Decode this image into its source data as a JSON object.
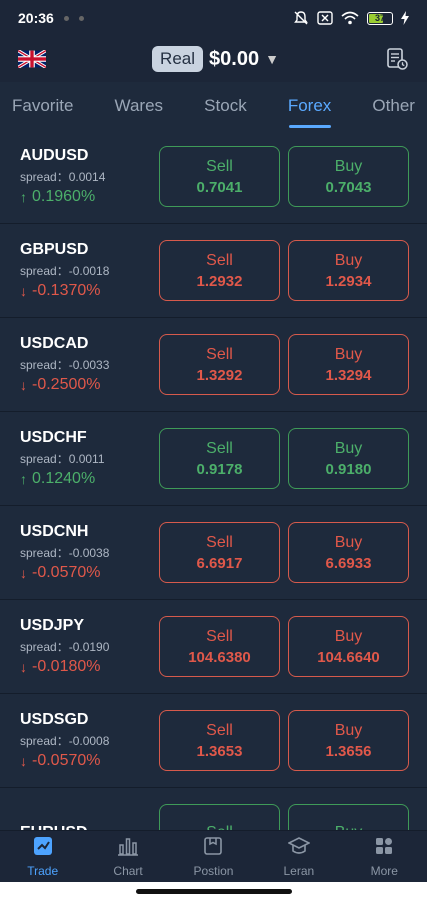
{
  "status": {
    "time": "20:36",
    "battery": "37"
  },
  "header": {
    "account_type": "Real",
    "balance": "$0.00",
    "caret": "▼"
  },
  "tabs": [
    {
      "label": "Favorite",
      "active": false
    },
    {
      "label": "Wares",
      "active": false
    },
    {
      "label": "Stock",
      "active": false
    },
    {
      "label": "Forex",
      "active": true
    },
    {
      "label": "Other",
      "active": false
    }
  ],
  "quotes": [
    {
      "symbol": "AUDUSD",
      "spread": "spread：0.0014",
      "change": "0.1960%",
      "direction": "up",
      "sell_label": "Sell",
      "sell": "0.7041",
      "buy_label": "Buy",
      "buy": "0.7043",
      "color": "green"
    },
    {
      "symbol": "GBPUSD",
      "spread": "spread：-0.0018",
      "change": "-0.1370%",
      "direction": "down",
      "sell_label": "Sell",
      "sell": "1.2932",
      "buy_label": "Buy",
      "buy": "1.2934",
      "color": "red"
    },
    {
      "symbol": "USDCAD",
      "spread": "spread：-0.0033",
      "change": "-0.2500%",
      "direction": "down",
      "sell_label": "Sell",
      "sell": "1.3292",
      "buy_label": "Buy",
      "buy": "1.3294",
      "color": "red"
    },
    {
      "symbol": "USDCHF",
      "spread": "spread：0.0011",
      "change": "0.1240%",
      "direction": "up",
      "sell_label": "Sell",
      "sell": "0.9178",
      "buy_label": "Buy",
      "buy": "0.9180",
      "color": "green"
    },
    {
      "symbol": "USDCNH",
      "spread": "spread：-0.0038",
      "change": "-0.0570%",
      "direction": "down",
      "sell_label": "Sell",
      "sell": "6.6917",
      "buy_label": "Buy",
      "buy": "6.6933",
      "color": "red"
    },
    {
      "symbol": "USDJPY",
      "spread": "spread：-0.0190",
      "change": "-0.0180%",
      "direction": "down",
      "sell_label": "Sell",
      "sell": "104.6380",
      "buy_label": "Buy",
      "buy": "104.6640",
      "color": "red"
    },
    {
      "symbol": "USDSGD",
      "spread": "spread：-0.0008",
      "change": "-0.0570%",
      "direction": "down",
      "sell_label": "Sell",
      "sell": "1.3653",
      "buy_label": "Buy",
      "buy": "1.3656",
      "color": "red"
    },
    {
      "symbol": "EURUSD",
      "spread": "",
      "change": "",
      "direction": "up",
      "sell_label": "Sell",
      "sell": "",
      "buy_label": "Buy",
      "buy": "",
      "color": "green"
    }
  ],
  "nav": [
    {
      "label": "Trade",
      "icon": "trade-icon",
      "active": true
    },
    {
      "label": "Chart",
      "icon": "chart-icon",
      "active": false
    },
    {
      "label": "Postion",
      "icon": "position-icon",
      "active": false
    },
    {
      "label": "Leran",
      "icon": "learn-icon",
      "active": false
    },
    {
      "label": "More",
      "icon": "more-icon",
      "active": false
    }
  ],
  "colors": {
    "up": "#4caf6a",
    "down": "#e0584a",
    "accent": "#4da3ff",
    "background": "#1b2536"
  }
}
